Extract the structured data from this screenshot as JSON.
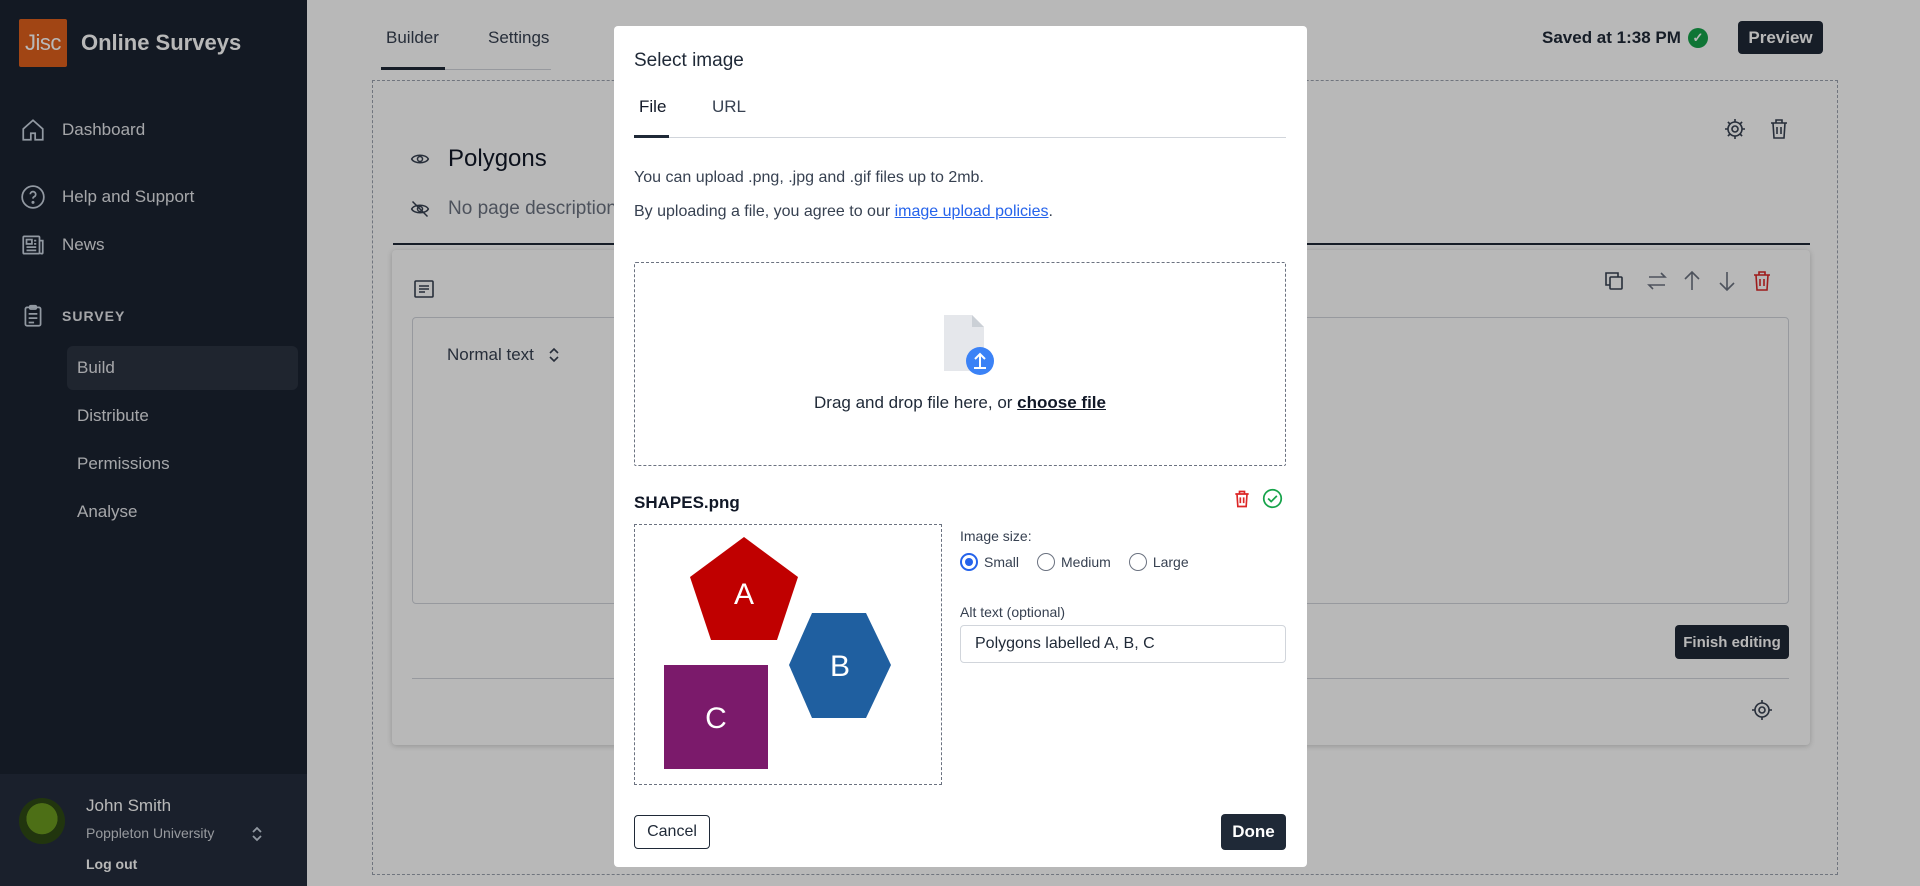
{
  "app": {
    "logo_text": "Jisc",
    "title": "Online Surveys"
  },
  "sidebar": {
    "items": [
      {
        "label": "Dashboard",
        "icon": "home-icon"
      },
      {
        "label": "Help and Support",
        "icon": "help-circle-icon"
      },
      {
        "label": "News",
        "icon": "news-icon"
      }
    ],
    "section_label": "SURVEY",
    "section_icon": "clipboard-icon",
    "sub_items": [
      {
        "label": "Build",
        "active": true
      },
      {
        "label": "Distribute",
        "active": false
      },
      {
        "label": "Permissions",
        "active": false
      },
      {
        "label": "Analyse",
        "active": false
      }
    ]
  },
  "user": {
    "name": "John Smith",
    "organization": "Poppleton University",
    "logout_label": "Log out"
  },
  "header": {
    "tabs": [
      {
        "label": "Builder",
        "active": true
      },
      {
        "label": "Settings",
        "active": false
      }
    ],
    "saved_text": "Saved at 1:38 PM",
    "preview_label": "Preview"
  },
  "page": {
    "title": "Polygons",
    "description_placeholder": "No page description"
  },
  "editor": {
    "text_style": "Normal text",
    "finish_label": "Finish editing"
  },
  "modal": {
    "title": "Select image",
    "tabs": [
      {
        "label": "File",
        "active": true
      },
      {
        "label": "URL",
        "active": false
      }
    ],
    "info_line1": "You can upload .png, .jpg and .gif files up to 2mb.",
    "info_line2_prefix": "By uploading a file, you agree to our ",
    "info_line2_link": "image upload policies",
    "info_line2_suffix": ".",
    "drop_text": "Drag and drop file here, or ",
    "choose_file": "choose file",
    "file_name": "SHAPES.png",
    "shapes": [
      {
        "label": "A",
        "shape": "pentagon",
        "color": "#c00000"
      },
      {
        "label": "B",
        "shape": "hexagon",
        "color": "#1f5fa0"
      },
      {
        "label": "C",
        "shape": "square",
        "color": "#7b1a6b"
      }
    ],
    "image_size_label": "Image size:",
    "size_options": [
      "Small",
      "Medium",
      "Large"
    ],
    "selected_size": "Small",
    "alt_label": "Alt text (optional)",
    "alt_value": "Polygons labelled A, B, C",
    "cancel_label": "Cancel",
    "done_label": "Done"
  },
  "colors": {
    "sidebar_bg": "#1b2331",
    "logo_bg": "#e0601d",
    "primary_dark": "#1f2937",
    "link": "#2563eb",
    "success": "#16a34a",
    "danger": "#dc2626"
  }
}
